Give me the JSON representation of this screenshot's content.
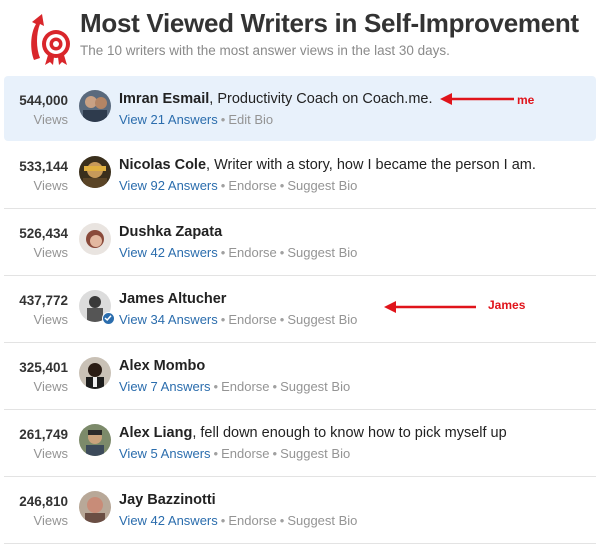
{
  "header": {
    "title": "Most Viewed Writers in Self-Improvement",
    "subtitle": "The 10 writers with the most answer views in the last 30 days."
  },
  "colors": {
    "accent": "#2b6dad",
    "highlight": "#e8f1fb",
    "annotation": "#e0141b",
    "logo": "#d9262b"
  },
  "writers": [
    {
      "views": "544,000",
      "views_label": "Views",
      "name": "Imran Esmail",
      "bio": ", Productivity Coach on Coach.me.",
      "answers": "View 21 Answers",
      "actions": [
        "Edit Bio"
      ],
      "verified": false
    },
    {
      "views": "533,144",
      "views_label": "Views",
      "name": "Nicolas Cole",
      "bio": ", Writer with a story, how I became the person I am.",
      "answers": "View 92 Answers",
      "actions": [
        "Endorse",
        "Suggest Bio"
      ],
      "verified": false
    },
    {
      "views": "526,434",
      "views_label": "Views",
      "name": "Dushka Zapata",
      "bio": "",
      "answers": "View 42 Answers",
      "actions": [
        "Endorse",
        "Suggest Bio"
      ],
      "verified": false
    },
    {
      "views": "437,772",
      "views_label": "Views",
      "name": "James Altucher",
      "bio": "",
      "answers": "View 34 Answers",
      "actions": [
        "Endorse",
        "Suggest Bio"
      ],
      "verified": true
    },
    {
      "views": "325,401",
      "views_label": "Views",
      "name": "Alex Mombo",
      "bio": "",
      "answers": "View 7 Answers",
      "actions": [
        "Endorse",
        "Suggest Bio"
      ],
      "verified": false
    },
    {
      "views": "261,749",
      "views_label": "Views",
      "name": "Alex Liang",
      "bio": ", fell down enough to know how to pick myself up",
      "answers": "View 5 Answers",
      "actions": [
        "Endorse",
        "Suggest Bio"
      ],
      "verified": false
    },
    {
      "views": "246,810",
      "views_label": "Views",
      "name": "Jay Bazzinotti",
      "bio": "",
      "answers": "View 42 Answers",
      "actions": [
        "Endorse",
        "Suggest Bio"
      ],
      "verified": false
    }
  ],
  "annotations": {
    "me_label": "me",
    "james_label": "James"
  }
}
